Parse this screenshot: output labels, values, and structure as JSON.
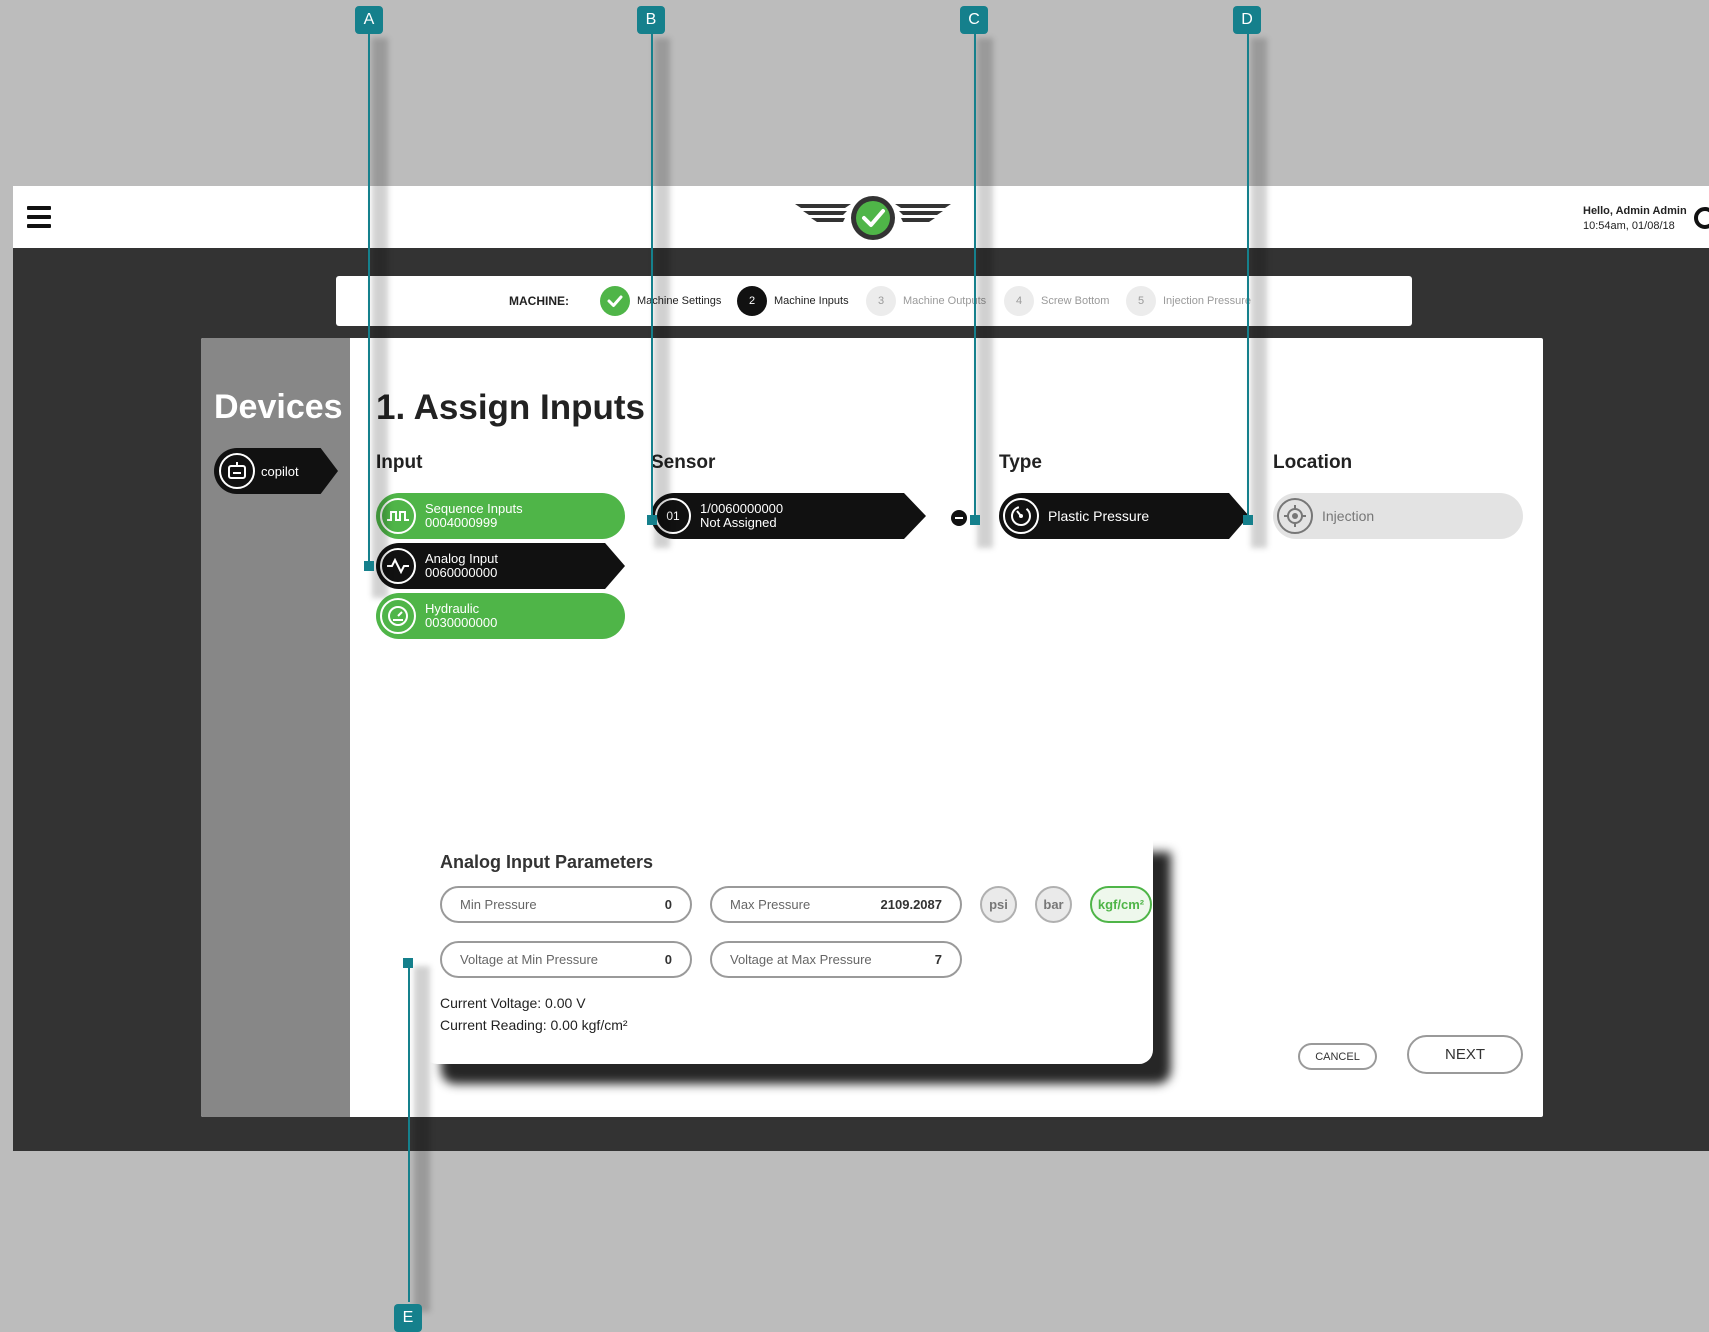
{
  "header": {
    "greeting": "Hello, Admin Admin",
    "datetime": "10:54am, 01/08/18"
  },
  "stepper": {
    "label": "MACHINE:",
    "steps": [
      {
        "num": "",
        "label": "Machine Settings",
        "state": "done"
      },
      {
        "num": "2",
        "label": "Machine Inputs",
        "state": "active"
      },
      {
        "num": "3",
        "label": "Machine Outputs",
        "state": "pending"
      },
      {
        "num": "4",
        "label": "Screw Bottom",
        "state": "pending"
      },
      {
        "num": "5",
        "label": "Injection Pressure",
        "state": "pending"
      }
    ]
  },
  "sidebar": {
    "title": "Devices",
    "device": "copilot"
  },
  "main": {
    "title": "1. Assign Inputs",
    "columns": {
      "input": "Input",
      "sensor": "Sensor",
      "type": "Type",
      "location": "Location"
    },
    "inputs": [
      {
        "name": "Sequence Inputs",
        "id": "0004000999",
        "state": "green",
        "icon": "sequence-wave-icon"
      },
      {
        "name": "Analog Input",
        "id": "0060000000",
        "state": "selected",
        "icon": "analog-wave-icon"
      },
      {
        "name": "Hydraulic",
        "id": "0030000000",
        "state": "green",
        "icon": "gauge-icon"
      }
    ],
    "sensor": {
      "num": "01",
      "id": "1/0060000000",
      "status": "Not Assigned"
    },
    "type": {
      "label": "Plastic Pressure",
      "icon": "pressure-gauge-icon"
    },
    "location": {
      "label": "Injection",
      "icon": "target-icon"
    }
  },
  "params": {
    "title": "Analog Input Parameters",
    "min_pressure": {
      "label": "Min Pressure",
      "value": "0"
    },
    "max_pressure": {
      "label": "Max Pressure",
      "value": "2109.2087"
    },
    "voltage_min": {
      "label": "Voltage at Min Pressure",
      "value": "0"
    },
    "voltage_max": {
      "label": "Voltage at Max Pressure",
      "value": "7"
    },
    "units": [
      "psi",
      "bar",
      "kgf/cm²"
    ],
    "selected_unit": "kgf/cm²",
    "current_voltage": "Current Voltage: 0.00 V",
    "current_reading": "Current Reading: 0.00 kgf/cm²"
  },
  "actions": {
    "cancel": "CANCEL",
    "next": "NEXT"
  },
  "callouts": [
    "A",
    "B",
    "C",
    "D",
    "E"
  ],
  "colors": {
    "accent_green": "#4fb548",
    "callout_teal": "#15808c",
    "dark": "#111111"
  }
}
